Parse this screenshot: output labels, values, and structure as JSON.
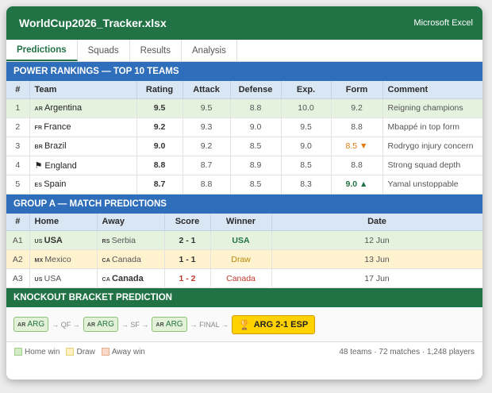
{
  "window": {
    "file_name": "WorldCup2026_Tracker.xlsx",
    "app_name": "Microsoft Excel"
  },
  "tabs": [
    "Predictions",
    "Squads",
    "Results",
    "Analysis"
  ],
  "rankings": {
    "title": "POWER RANKINGS — TOP 10 TEAMS",
    "headers": [
      "#",
      "Team",
      "Rating",
      "Attack",
      "Defense",
      "Exp.",
      "Form",
      "Comment"
    ],
    "rows": [
      {
        "rank": "1",
        "code": "AR",
        "team": "Argentina",
        "rating": "9.5",
        "attack": "9.5",
        "defense": "8.8",
        "exp": "10.0",
        "form": "9.2",
        "comment": "Reigning champions"
      },
      {
        "rank": "2",
        "code": "FR",
        "team": "France",
        "rating": "9.2",
        "attack": "9.3",
        "defense": "9.0",
        "exp": "9.5",
        "form": "8.8",
        "comment": "Mbappé in top form"
      },
      {
        "rank": "3",
        "code": "BR",
        "team": "Brazil",
        "rating": "9.0",
        "attack": "9.2",
        "defense": "8.5",
        "exp": "9.0",
        "form": "8.5 ▼",
        "comment": "Rodrygo injury concern"
      },
      {
        "rank": "4",
        "code": "",
        "team": "England",
        "rating": "8.8",
        "attack": "8.7",
        "defense": "8.9",
        "exp": "8.5",
        "form": "8.8",
        "comment": "Strong squad depth"
      },
      {
        "rank": "5",
        "code": "ES",
        "team": "Spain",
        "rating": "8.7",
        "attack": "8.8",
        "defense": "8.5",
        "exp": "8.3",
        "form": "9.0 ▲",
        "comment": "Yamal unstoppable"
      }
    ]
  },
  "group": {
    "title": "GROUP A — MATCH PREDICTIONS",
    "headers": [
      "#",
      "Home",
      "Away",
      "Score",
      "Winner",
      "Date"
    ],
    "rows": [
      {
        "id": "A1",
        "home_code": "US",
        "home": "USA",
        "away_code": "RS",
        "away": "Serbia",
        "score": "2 - 1",
        "winner": "USA",
        "date": "12 Jun"
      },
      {
        "id": "A2",
        "home_code": "MX",
        "home": "Mexico",
        "away_code": "CA",
        "away": "Canada",
        "score": "1 - 1",
        "winner": "Draw",
        "date": "13 Jun"
      },
      {
        "id": "A3",
        "home_code": "US",
        "home": "USA",
        "away_code": "CA",
        "away": "Canada",
        "score": "1 - 2",
        "winner": "Canada",
        "date": "17 Jun"
      }
    ]
  },
  "knockout": {
    "title": "KNOCKOUT BRACKET PREDICTION",
    "code": "AR",
    "team": "ARG",
    "arrow_qf": "→ QF →",
    "arrow_sf": "→ SF →",
    "arrow_final": "→ FINAL →",
    "final_label": "ARG 2-1 ESP"
  },
  "legend": {
    "home_win": "Home win",
    "draw": "Draw",
    "away_win": "Away win",
    "colors": {
      "home_win": "#d4ecc6",
      "draw": "#fff0c0",
      "away_win": "#fbd9c8"
    }
  },
  "stats": "48 teams · 72 matches · 1,248 players",
  "colors": {
    "excel_green": "#217346",
    "section_blue": "#2f6eba",
    "final_gold": "#ffd200"
  }
}
